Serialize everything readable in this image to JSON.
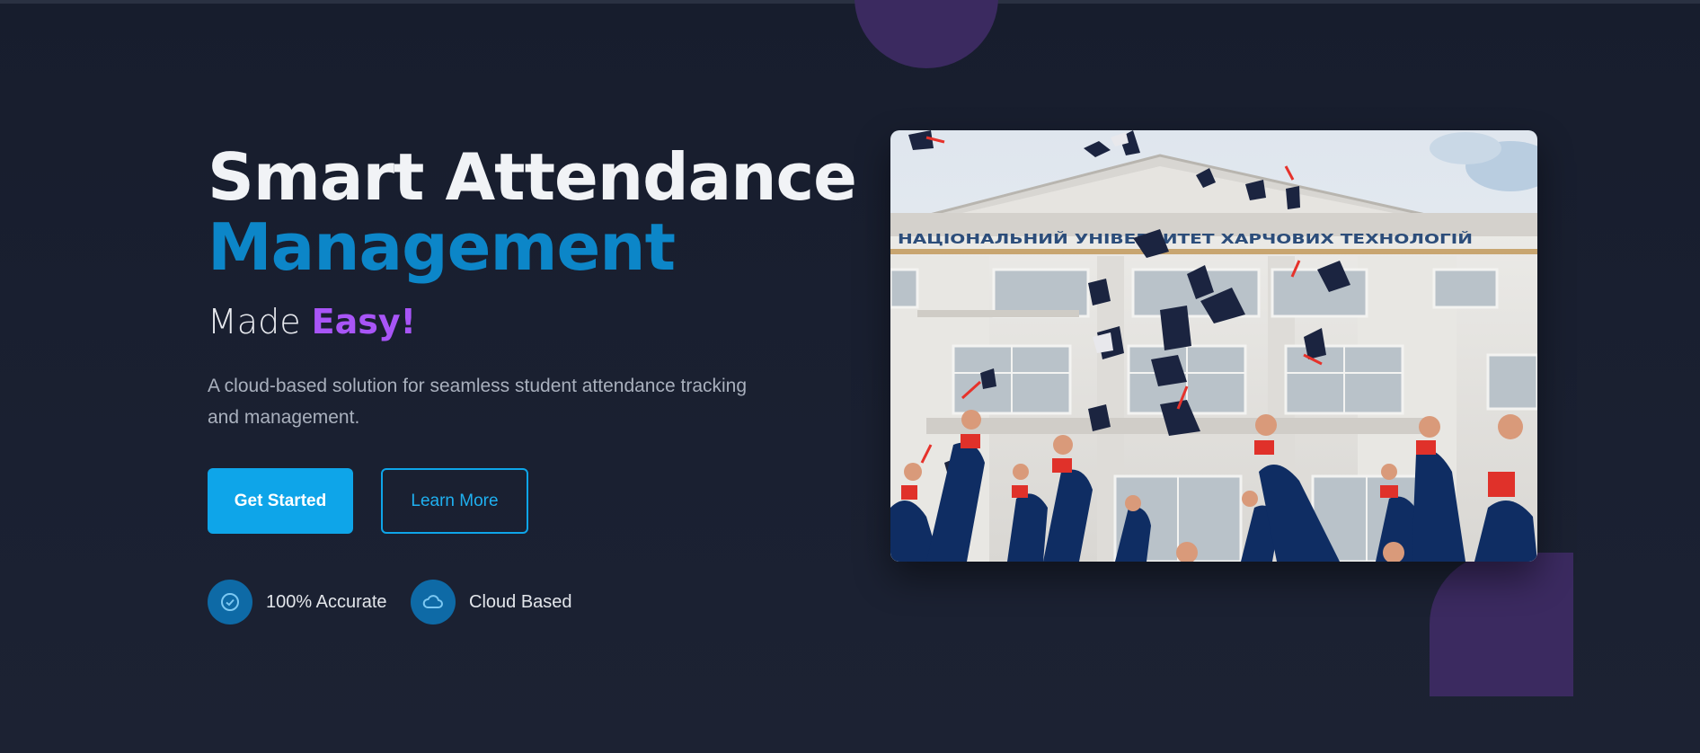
{
  "hero": {
    "title_line1": "Smart Attendance",
    "title_line2": "Management",
    "subtitle_prefix": "Made ",
    "subtitle_accent": "Easy!",
    "description": "A cloud-based solution for seamless student attendance tracking and management."
  },
  "buttons": {
    "primary": "Get Started",
    "secondary": "Learn More"
  },
  "features": [
    {
      "label": "100% Accurate",
      "icon": "check-circle-icon"
    },
    {
      "label": "Cloud Based",
      "icon": "cloud-icon"
    }
  ],
  "image": {
    "building_sign": "НАЦІОНАЛЬНИЙ УНІВЕРСИТЕТ ХАРЧОВИХ ТЕХНОЛОГІЙ"
  },
  "colors": {
    "background": "#171d2d",
    "title_primary": "#f1f3f6",
    "title_accent": "#0c86c8",
    "subtitle_accent": "#a855f7",
    "button_primary": "#0ea5e9",
    "decor_purple": "#3b2a60"
  }
}
